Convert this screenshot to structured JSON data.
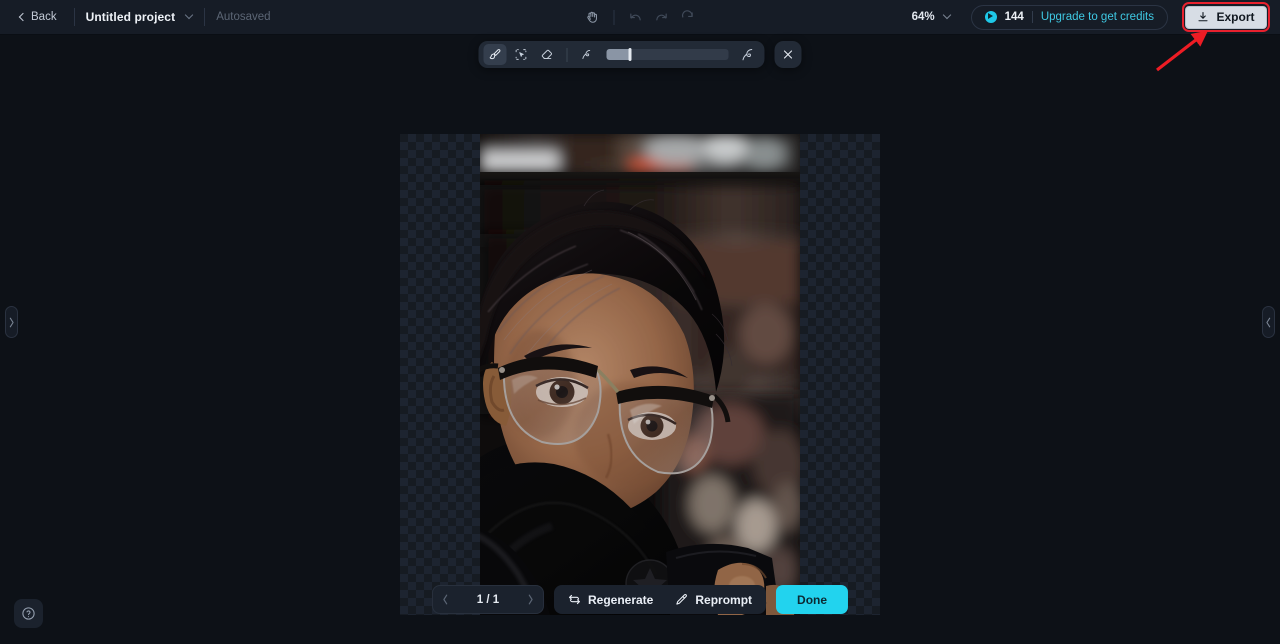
{
  "header": {
    "back_label": "Back",
    "project_name": "Untitled project",
    "save_status": "Autosaved",
    "zoom_level": "64%",
    "credits_count": "144",
    "upgrade_label": "Upgrade to get credits",
    "export_label": "Export",
    "icons": {
      "back_chevron": "chevron-left-icon",
      "project_caret": "chevron-down-icon",
      "pan_tool": "hand-icon",
      "undo": "undo-icon",
      "redo": "redo-icon",
      "reset": "refresh-icon",
      "zoom_caret": "chevron-down-icon",
      "credit_coin": "coin-icon",
      "export": "download-icon"
    }
  },
  "toolbar": {
    "tools": [
      {
        "name": "brush-tool",
        "icon": "paintbrush-icon",
        "active": true
      },
      {
        "name": "magic-select-tool",
        "icon": "magic-cursor-icon",
        "active": false
      },
      {
        "name": "eraser-tool",
        "icon": "eraser-icon",
        "active": false
      }
    ],
    "brush_size_small_icon": "brush-size-small-icon",
    "brush_size_large_icon": "brush-size-large-icon",
    "brush_size_percent": 20,
    "close_icon": "close-icon"
  },
  "canvas": {
    "artwork_alt": "portrait of person with dark hair, glasses and black turtleneck holding phone",
    "transparency_checkerboard": true
  },
  "panels": {
    "left_handle_icon": "chevron-right-icon",
    "right_handle_icon": "chevron-left-icon"
  },
  "bottom": {
    "prev_icon": "chevron-left-icon",
    "page_label": "1 / 1",
    "next_icon": "chevron-right-icon",
    "regenerate_label": "Regenerate",
    "regenerate_icon": "refresh-arrows-icon",
    "reprompt_label": "Reprompt",
    "reprompt_icon": "pencil-icon",
    "done_label": "Done",
    "help_icon": "question-mark-icon"
  },
  "annotation": {
    "arrow_color": "#ed1c24",
    "highlight_color": "#e8212e",
    "target": "export-button"
  },
  "colors": {
    "app_background": "#0d1117",
    "header_background": "#161c26",
    "accent_cyan": "#22d3ee",
    "link_cyan": "#3fc9e3",
    "export_button": "#d7dde5"
  }
}
